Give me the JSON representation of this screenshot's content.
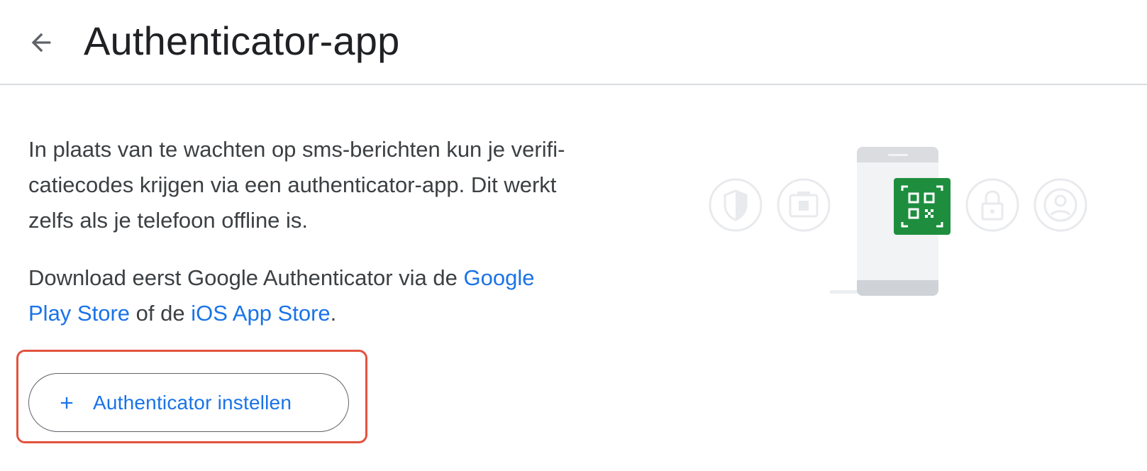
{
  "header": {
    "back_icon": "arrow-left-icon",
    "title": "Authenticator-app"
  },
  "content": {
    "paragraph1": "In plaats van te wachten op sms-berichten kun je verifi-catiecodes krijgen via een authenticator-app. Dit werkt zelfs als je telefoon offline is.",
    "paragraph2_prefix": "Download eerst Google Authenticator via de ",
    "link_play_store": "Google Play Store",
    "paragraph2_middle": " of de ",
    "link_app_store": "iOS App Store",
    "paragraph2_suffix": "."
  },
  "setup_button": {
    "icon": "plus-icon",
    "label": "Authenticator instellen"
  },
  "illustration": {
    "icons": [
      "shield-icon",
      "camera-icon",
      "phone-icon",
      "qr-code-icon",
      "lock-icon",
      "account-circle-icon"
    ]
  },
  "colors": {
    "link": "#1a73e8",
    "highlight_border": "#e2533f",
    "qr_green": "#1e8e3e",
    "text": "#3c4043",
    "title": "#202124"
  }
}
